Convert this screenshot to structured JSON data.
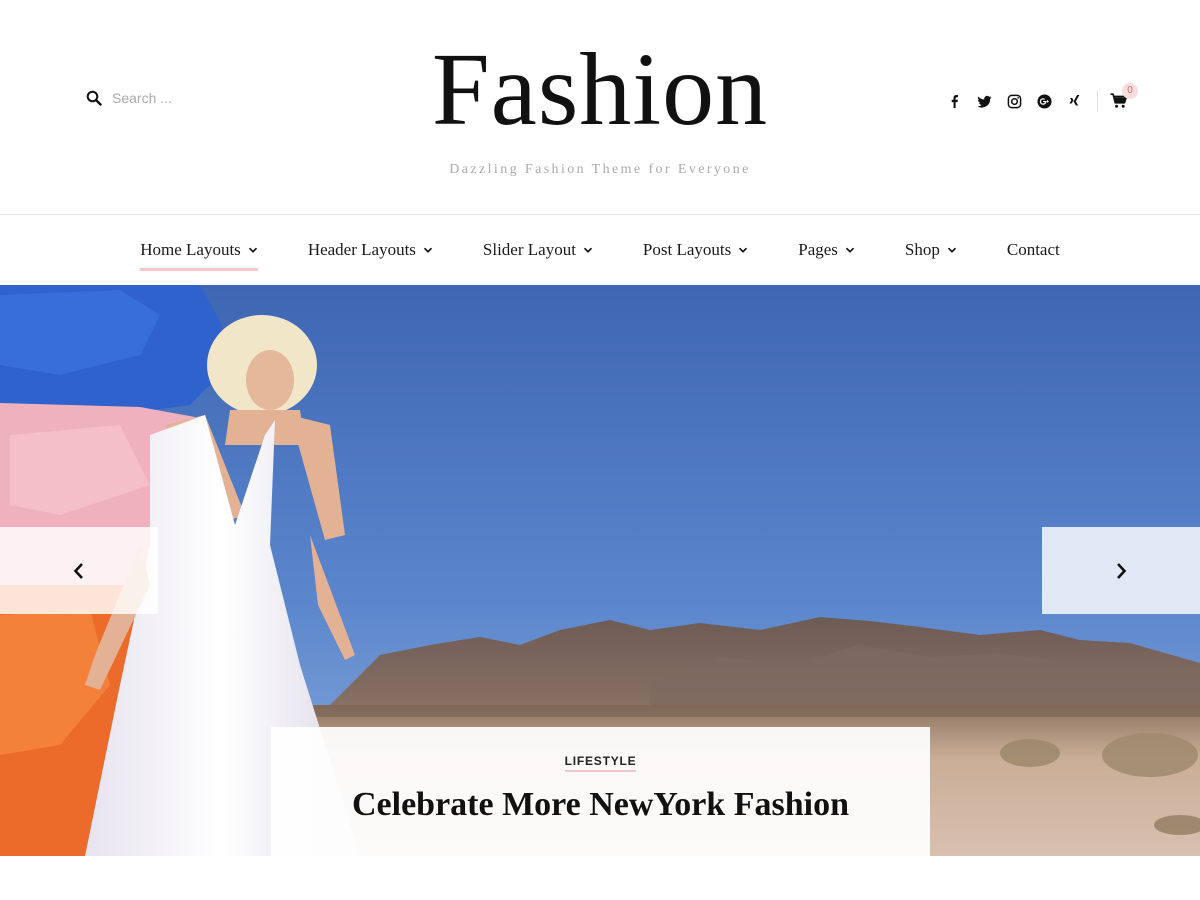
{
  "header": {
    "search": {
      "placeholder": "Search ..."
    },
    "logo": "Fashion",
    "tagline": "Dazzling Fashion Theme for Everyone",
    "social": [
      "facebook-icon",
      "twitter-icon",
      "instagram-icon",
      "google-plus-icon",
      "xing-icon"
    ],
    "cart": {
      "icon": "cart-icon",
      "count": "0"
    }
  },
  "nav": {
    "items": [
      {
        "label": "Home Layouts",
        "has_dropdown": true,
        "active": true
      },
      {
        "label": "Header Layouts",
        "has_dropdown": true
      },
      {
        "label": "Slider Layout",
        "has_dropdown": true
      },
      {
        "label": "Post Layouts",
        "has_dropdown": true
      },
      {
        "label": "Pages",
        "has_dropdown": true
      },
      {
        "label": "Shop",
        "has_dropdown": true
      },
      {
        "label": "Contact",
        "has_dropdown": false
      }
    ]
  },
  "slider": {
    "category": "LIFESTYLE",
    "title": "Celebrate More NewYork Fashion",
    "prev_icon": "chevron-left-icon",
    "next_icon": "chevron-right-icon"
  },
  "colors": {
    "accent": "#f3c7c7",
    "text": "#111111",
    "muted": "#aaaaaa"
  }
}
